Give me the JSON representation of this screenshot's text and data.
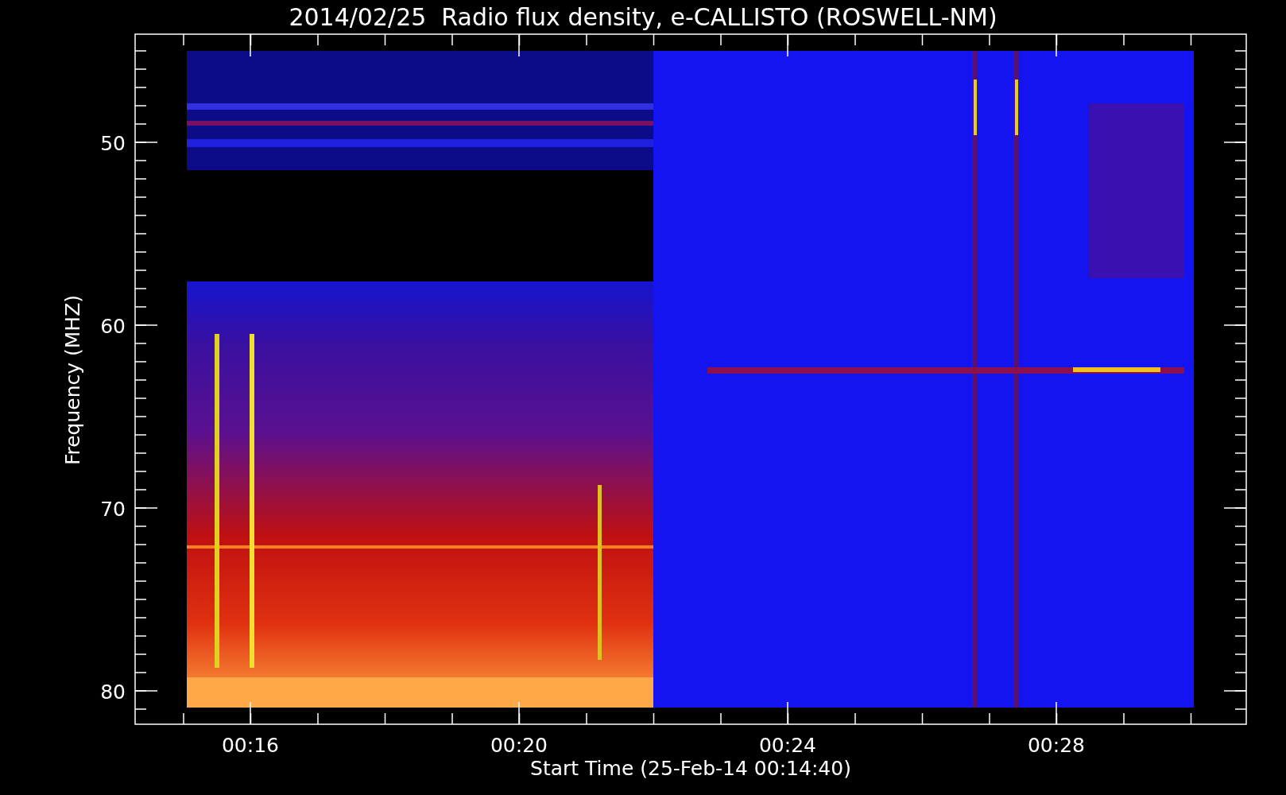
{
  "title": "2014/02/25  Radio flux density, e-CALLISTO (ROSWELL-NM)",
  "y_axis": {
    "label": "Frequency (MHZ)",
    "ticks": [
      "50",
      "60",
      "70",
      "80"
    ]
  },
  "x_axis": {
    "label": "Start Time (25-Feb-14 00:14:40)",
    "ticks": [
      "00:16",
      "00:20",
      "00:24",
      "00:28"
    ]
  }
}
